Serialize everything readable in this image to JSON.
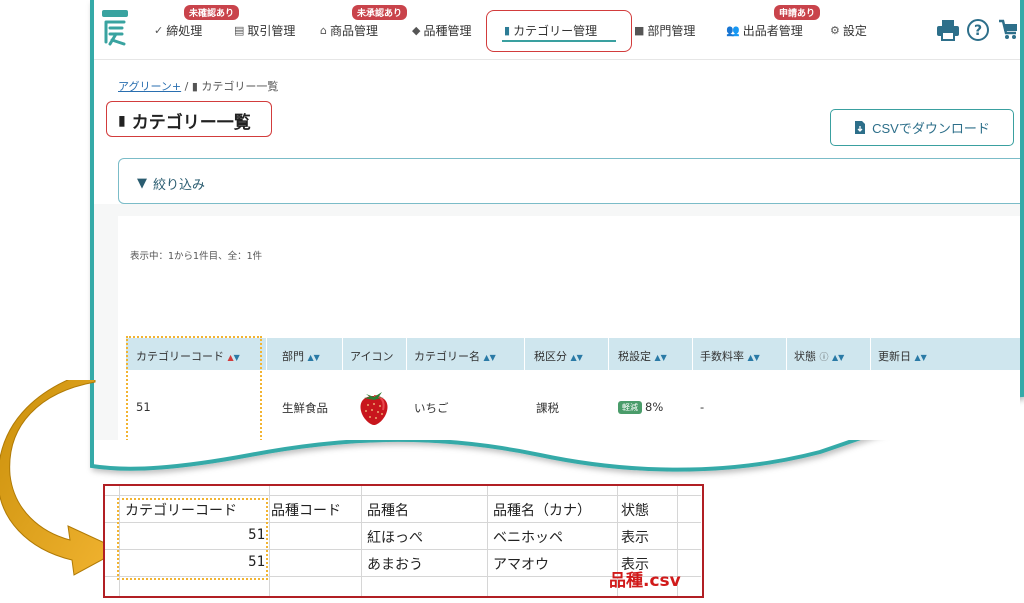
{
  "nav": {
    "items": [
      {
        "label": "締処理",
        "icon": "check-icon",
        "badge": "未確認あり"
      },
      {
        "label": "取引管理",
        "icon": "ledger-icon",
        "badge": ""
      },
      {
        "label": "商品管理",
        "icon": "basket-icon",
        "badge": "未承認あり"
      },
      {
        "label": "品種管理",
        "icon": "tag-icon",
        "badge": ""
      },
      {
        "label": "カテゴリー管理",
        "icon": "bookmark-icon",
        "badge": ""
      },
      {
        "label": "部門管理",
        "icon": "folder-icon",
        "badge": ""
      },
      {
        "label": "出品者管理",
        "icon": "users-icon",
        "badge": "申請あり"
      },
      {
        "label": "設定",
        "icon": "gear-icon",
        "badge": ""
      }
    ],
    "active": "カテゴリー管理",
    "right_icons": [
      "printer-icon",
      "help-icon",
      "cart-icon"
    ]
  },
  "breadcrumb": {
    "home": "アグリーン+",
    "separator": "/",
    "current": "カテゴリー一覧"
  },
  "page": {
    "title": "カテゴリー一覧",
    "csv_button": "CSVでダウンロード"
  },
  "filter": {
    "label": "絞り込み"
  },
  "table": {
    "info": "表示中：1から1件目、全：1件",
    "headers": [
      "カテゴリーコード",
      "部門",
      "アイコン",
      "カテゴリー名",
      "税区分",
      "税設定",
      "手数料率",
      "状態",
      "更新日"
    ],
    "rows": [
      {
        "code": "51",
        "department": "生鮮食品",
        "icon": "strawberry",
        "name": "いちご",
        "tax_class": "課税",
        "tax_badge": "軽減",
        "tax_rate": "8%",
        "fee": "-",
        "status": "",
        "updated": ""
      }
    ]
  },
  "csv": {
    "filename": "品種.csv",
    "headers": [
      "カテゴリーコード",
      "品種コード",
      "品種名",
      "品種名（カナ）",
      "状態"
    ],
    "rows": [
      [
        "51",
        "",
        "紅ほっぺ",
        "ベニホッペ",
        "表示"
      ],
      [
        "51",
        "",
        "あまおう",
        "アマオウ",
        "表示"
      ]
    ]
  },
  "colors": {
    "teal": "#3aa0a0",
    "red": "#d23c3c",
    "yellow": "#f2b431",
    "header_bg": "#cfe6ee"
  }
}
